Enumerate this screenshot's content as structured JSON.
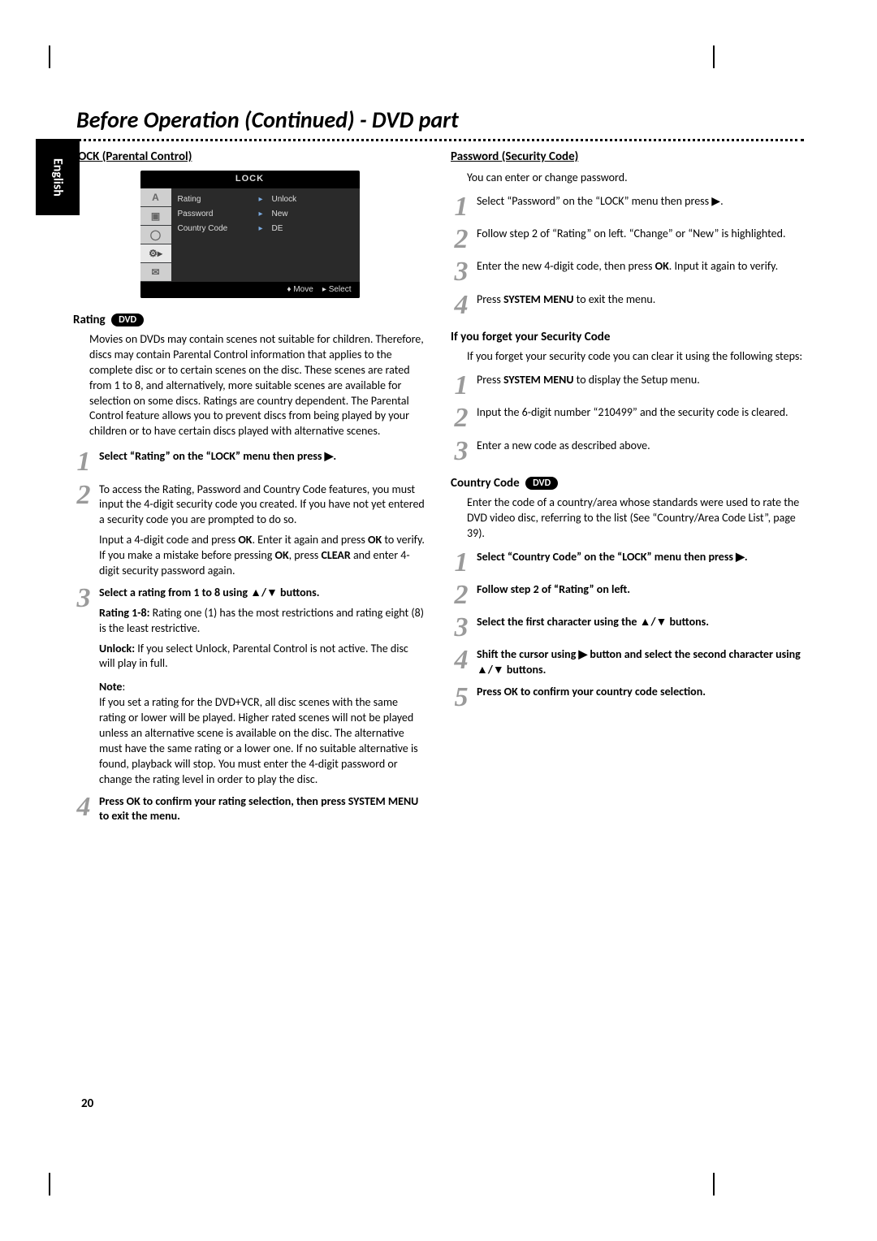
{
  "title": "Before Operation (Continued) - DVD part",
  "language_tab": "English",
  "page_number": "20",
  "left": {
    "heading": "LOCK (Parental Control)",
    "osd": {
      "title": "LOCK",
      "rows": [
        {
          "label": "Rating",
          "value": "Unlock"
        },
        {
          "label": "Password",
          "value": "New"
        },
        {
          "label": "Country Code",
          "value": "DE"
        }
      ],
      "footer_move": "Move",
      "footer_select": "Select",
      "tab_icons": [
        "A",
        "▣",
        "◯",
        "⚙▸",
        "✉"
      ]
    },
    "rating_heading": "Rating",
    "dvd_badge": "DVD",
    "rating_intro": "Movies on DVDs may contain scenes not suitable for children. Therefore, discs may contain Parental Control information that applies to the complete disc or to certain scenes on the disc. These scenes are rated from 1 to 8, and alternatively, more suitable scenes are available for selection on some discs. Ratings are country dependent. The Parental Control feature allows you to prevent discs from being played by your children or to have certain discs played with alternative scenes.",
    "steps": {
      "s1": "Select “Rating” on the “LOCK” menu then press ▶.",
      "s2a": "To access the Rating, Password and Country Code features, you must input the 4-digit security code you created. If you have not yet entered a security code you are prompted to do so.",
      "s2b_pre": "Input a 4-digit code and press ",
      "s2b_ok1": "OK",
      "s2b_mid1": ". Enter it again and press ",
      "s2b_ok2": "OK",
      "s2b_mid2": " to verify. If you make a mistake before pressing ",
      "s2b_ok3": "OK",
      "s2b_mid3": ", press ",
      "s2b_clear": "CLEAR",
      "s2b_end": " and enter 4-digit security password again.",
      "s3_line1": "Select a rating from 1 to 8 using ▲/▼ buttons.",
      "s3_r18_label": "Rating 1-8:",
      "s3_r18_text": " Rating one (1) has the most restrictions and rating eight (8) is the least restrictive.",
      "s3_unlock_label": "Unlock:",
      "s3_unlock_text": " If you select Unlock, Parental Control is not active. The disc will play in full.",
      "note_label": "Note",
      "note_text": "If you set a rating for the DVD+VCR, all disc scenes with the same rating or lower will be played. Higher rated scenes will not be played unless an alternative scene is available on the disc. The alternative must have the same rating or a lower one. If no suitable alternative is found, playback will stop. You must enter the 4-digit password or change the rating level in order to play the disc.",
      "s4": "Press OK to confirm your rating selection, then press SYSTEM MENU to exit the menu."
    }
  },
  "right": {
    "pw_heading": "Password (Security Code)",
    "pw_intro": "You can enter or change password.",
    "pw_s1": "Select “Password” on the “LOCK” menu then press ▶.",
    "pw_s2": "Follow step 2 of “Rating” on left. “Change” or “New” is highlighted.",
    "pw_s3_a": "Enter the new 4-digit code, then press ",
    "pw_s3_ok": "OK",
    "pw_s3_b": ". Input it again to verify.",
    "pw_s4_a": "Press ",
    "pw_s4_b": "SYSTEM MENU",
    "pw_s4_c": " to exit the menu.",
    "forgot_heading": "If you forget your Security Code",
    "forgot_intro": "If you forget your security code you can clear it using the following steps:",
    "fg_s1_a": "Press ",
    "fg_s1_b": "SYSTEM MENU",
    "fg_s1_c": " to display the Setup menu.",
    "fg_s2": "Input the 6-digit number “210499” and the security code is cleared.",
    "fg_s3": "Enter a new code as described above.",
    "cc_heading": "Country Code",
    "cc_intro": "Enter the code of a country/area whose standards were used to rate the DVD video disc, referring to the list (See “Country/Area Code List”, page 39).",
    "cc_s1": "Select “Country Code” on the “LOCK” menu then press ▶.",
    "cc_s2": "Follow step 2 of “Rating” on left.",
    "cc_s3": "Select the first character using the ▲/▼ buttons.",
    "cc_s4": "Shift the cursor using ▶ button and select the second character using ▲/▼ buttons.",
    "cc_s5": "Press OK to confirm your country code selection."
  }
}
